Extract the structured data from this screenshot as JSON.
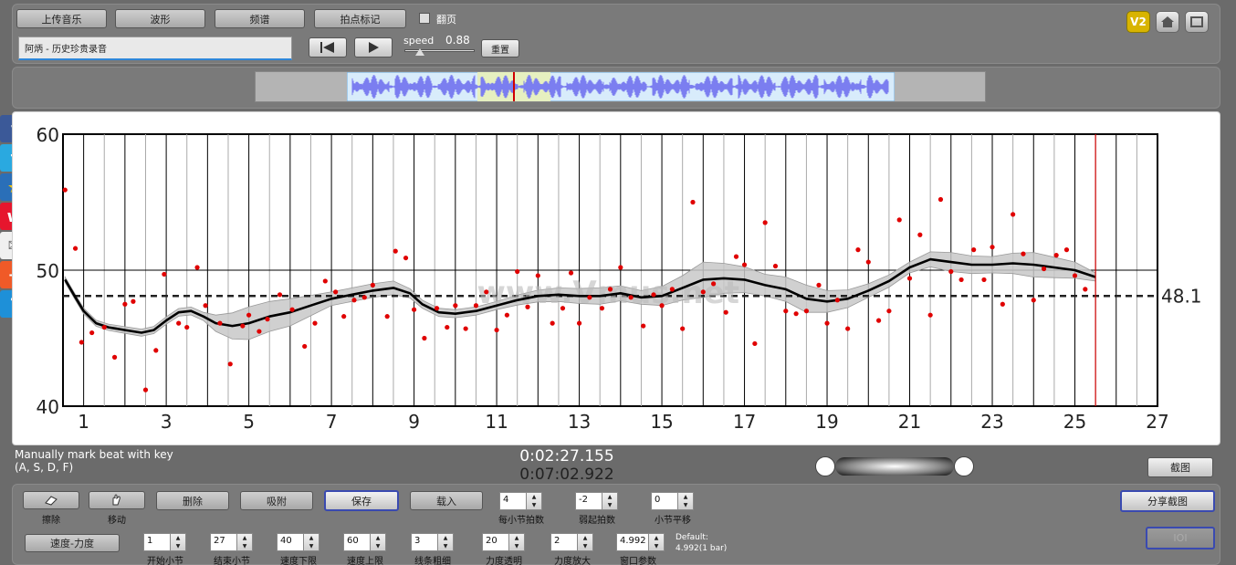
{
  "toolbar": {
    "upload_label": "上传音乐",
    "waveform_label": "波形",
    "spectrum_label": "频谱",
    "beat_label": "拍点标记",
    "page_flip_label": "翻页",
    "track_title": "阿炳 - 历史珍贵录音",
    "speed_label": "speed",
    "speed_value": "0.88",
    "reset_label": "重置",
    "v2_label": "V2"
  },
  "status": {
    "hint_line1": "Manually mark beat with key",
    "hint_line2": "(A, S, D, F)",
    "current_time": "0:02:27.155",
    "total_time": "0:07:02.922",
    "screenshot_label": "截图"
  },
  "controls": {
    "erase_label": "擦除",
    "move_label": "移动",
    "delete_label": "删除",
    "snap_label": "吸附",
    "save_label": "保存",
    "load_label": "载入",
    "mode_label": "速度-力度",
    "share_label": "分享截图",
    "ioi_label": "IOI",
    "default_line1": "Default:",
    "default_line2": "4.992(1 bar)",
    "spinners_row1": [
      {
        "name": "beats-per-bar",
        "value": "4",
        "label": "每小节拍数"
      },
      {
        "name": "pickup-beats",
        "value": "-2",
        "label": "弱起拍数"
      },
      {
        "name": "bar-offset",
        "value": "0",
        "label": "小节平移"
      }
    ],
    "spinners_row2": [
      {
        "name": "start-bar",
        "value": "1",
        "label": "开始小节"
      },
      {
        "name": "end-bar",
        "value": "27",
        "label": "结束小节"
      },
      {
        "name": "tempo-lower",
        "value": "40",
        "label": "速度下限"
      },
      {
        "name": "tempo-upper",
        "value": "60",
        "label": "速度上限"
      },
      {
        "name": "line-width",
        "value": "3",
        "label": "线条粗细"
      },
      {
        "name": "dynamics-transparency",
        "value": "20",
        "label": "力度透明"
      },
      {
        "name": "dynamics-zoom",
        "value": "2",
        "label": "力度放大"
      },
      {
        "name": "window-param",
        "value": "4.992",
        "label": "窗口参数"
      }
    ]
  },
  "colors": {
    "points": "#e00000",
    "curve": "#000000",
    "band": "#c8c8c8",
    "waveform": "#7b7ef0",
    "cursor": "#d00000"
  },
  "chart_data": {
    "type": "scatter",
    "xlim": [
      0.5,
      27
    ],
    "ylim": [
      40,
      60
    ],
    "x_ticks": [
      1,
      3,
      5,
      7,
      9,
      11,
      13,
      15,
      17,
      19,
      21,
      23,
      25,
      27
    ],
    "y_ticks": [
      40,
      50,
      60
    ],
    "mean_value": 48.1,
    "mean_label": "48.1",
    "cursor_x": 25.5,
    "watermark": "www.Vmus.net",
    "points": [
      [
        0.55,
        55.9
      ],
      [
        0.8,
        51.6
      ],
      [
        0.95,
        44.7
      ],
      [
        1.2,
        45.4
      ],
      [
        1.5,
        45.8
      ],
      [
        1.75,
        43.6
      ],
      [
        2.0,
        47.5
      ],
      [
        2.2,
        47.7
      ],
      [
        2.5,
        41.2
      ],
      [
        2.75,
        44.1
      ],
      [
        2.95,
        49.7
      ],
      [
        3.3,
        46.1
      ],
      [
        3.5,
        45.8
      ],
      [
        3.75,
        50.2
      ],
      [
        3.95,
        47.4
      ],
      [
        4.3,
        46.1
      ],
      [
        4.55,
        43.1
      ],
      [
        4.85,
        45.9
      ],
      [
        5.0,
        46.7
      ],
      [
        5.25,
        45.5
      ],
      [
        5.45,
        46.4
      ],
      [
        5.75,
        48.2
      ],
      [
        6.05,
        47.1
      ],
      [
        6.35,
        44.4
      ],
      [
        6.6,
        46.1
      ],
      [
        6.85,
        49.2
      ],
      [
        7.1,
        48.4
      ],
      [
        7.3,
        46.6
      ],
      [
        7.55,
        47.8
      ],
      [
        7.8,
        48.0
      ],
      [
        8.0,
        48.9
      ],
      [
        8.35,
        46.6
      ],
      [
        8.55,
        51.4
      ],
      [
        8.8,
        50.9
      ],
      [
        9.0,
        47.1
      ],
      [
        9.25,
        45.0
      ],
      [
        9.55,
        47.2
      ],
      [
        9.8,
        45.8
      ],
      [
        10.0,
        47.4
      ],
      [
        10.25,
        45.7
      ],
      [
        10.5,
        47.4
      ],
      [
        10.75,
        48.4
      ],
      [
        11.0,
        45.6
      ],
      [
        11.25,
        46.7
      ],
      [
        11.5,
        49.9
      ],
      [
        11.75,
        47.3
      ],
      [
        12.0,
        49.6
      ],
      [
        12.35,
        46.1
      ],
      [
        12.6,
        47.2
      ],
      [
        12.8,
        49.8
      ],
      [
        13.0,
        46.1
      ],
      [
        13.25,
        48.0
      ],
      [
        13.55,
        47.2
      ],
      [
        13.75,
        48.6
      ],
      [
        14.0,
        50.2
      ],
      [
        14.25,
        48.0
      ],
      [
        14.55,
        45.9
      ],
      [
        14.8,
        48.2
      ],
      [
        15.0,
        47.4
      ],
      [
        15.25,
        48.6
      ],
      [
        15.5,
        45.7
      ],
      [
        15.75,
        55.0
      ],
      [
        16.0,
        48.4
      ],
      [
        16.25,
        49.0
      ],
      [
        16.55,
        46.9
      ],
      [
        16.8,
        51.0
      ],
      [
        17.0,
        50.4
      ],
      [
        17.25,
        44.6
      ],
      [
        17.5,
        53.5
      ],
      [
        17.75,
        50.3
      ],
      [
        18.0,
        47.0
      ],
      [
        18.25,
        46.8
      ],
      [
        18.5,
        47.0
      ],
      [
        18.8,
        48.9
      ],
      [
        19.0,
        46.1
      ],
      [
        19.25,
        47.8
      ],
      [
        19.5,
        45.7
      ],
      [
        19.75,
        51.5
      ],
      [
        20.0,
        50.6
      ],
      [
        20.25,
        46.3
      ],
      [
        20.5,
        47.0
      ],
      [
        20.75,
        53.7
      ],
      [
        21.0,
        49.4
      ],
      [
        21.25,
        52.6
      ],
      [
        21.5,
        46.7
      ],
      [
        21.75,
        55.2
      ],
      [
        22.0,
        49.9
      ],
      [
        22.25,
        49.3
      ],
      [
        22.55,
        51.5
      ],
      [
        22.8,
        49.3
      ],
      [
        23.0,
        51.7
      ],
      [
        23.25,
        47.5
      ],
      [
        23.5,
        54.1
      ],
      [
        23.75,
        51.2
      ],
      [
        24.0,
        47.8
      ],
      [
        24.25,
        50.1
      ],
      [
        24.55,
        51.1
      ],
      [
        24.8,
        51.5
      ],
      [
        25.0,
        49.6
      ],
      [
        25.25,
        48.6
      ]
    ],
    "curve": [
      [
        0.55,
        49.3
      ],
      [
        0.8,
        48.0
      ],
      [
        1.0,
        47.0
      ],
      [
        1.3,
        46.1
      ],
      [
        1.6,
        45.8
      ],
      [
        2.0,
        45.6
      ],
      [
        2.4,
        45.4
      ],
      [
        2.7,
        45.6
      ],
      [
        3.0,
        46.3
      ],
      [
        3.3,
        46.9
      ],
      [
        3.6,
        47.0
      ],
      [
        3.9,
        46.6
      ],
      [
        4.2,
        46.1
      ],
      [
        4.6,
        45.9
      ],
      [
        5.0,
        46.1
      ],
      [
        5.5,
        46.6
      ],
      [
        6.0,
        46.9
      ],
      [
        6.5,
        47.4
      ],
      [
        7.0,
        47.9
      ],
      [
        7.5,
        48.2
      ],
      [
        8.0,
        48.5
      ],
      [
        8.5,
        48.7
      ],
      [
        8.9,
        48.3
      ],
      [
        9.2,
        47.5
      ],
      [
        9.6,
        46.9
      ],
      [
        10.0,
        46.8
      ],
      [
        10.5,
        47.0
      ],
      [
        11.0,
        47.4
      ],
      [
        11.5,
        47.8
      ],
      [
        12.0,
        48.1
      ],
      [
        12.5,
        48.2
      ],
      [
        13.0,
        48.1
      ],
      [
        13.5,
        48.1
      ],
      [
        14.0,
        48.3
      ],
      [
        14.5,
        48.0
      ],
      [
        15.0,
        48.1
      ],
      [
        15.5,
        48.7
      ],
      [
        16.0,
        49.3
      ],
      [
        16.5,
        49.4
      ],
      [
        17.0,
        49.3
      ],
      [
        17.5,
        48.9
      ],
      [
        18.0,
        48.6
      ],
      [
        18.5,
        47.9
      ],
      [
        19.0,
        47.7
      ],
      [
        19.5,
        47.9
      ],
      [
        20.0,
        48.5
      ],
      [
        20.5,
        49.2
      ],
      [
        21.0,
        50.2
      ],
      [
        21.5,
        50.8
      ],
      [
        22.0,
        50.6
      ],
      [
        22.5,
        50.4
      ],
      [
        23.0,
        50.4
      ],
      [
        23.5,
        50.5
      ],
      [
        24.0,
        50.4
      ],
      [
        24.5,
        50.2
      ],
      [
        25.0,
        50.0
      ],
      [
        25.5,
        49.5
      ]
    ],
    "band_width": [
      [
        0.55,
        0.2
      ],
      [
        3.9,
        0.3
      ],
      [
        4.5,
        0.9
      ],
      [
        5.0,
        1.2
      ],
      [
        6.0,
        1.0
      ],
      [
        7.0,
        0.5
      ],
      [
        8.5,
        0.5
      ],
      [
        9.0,
        0.3
      ],
      [
        11.0,
        0.3
      ],
      [
        12.5,
        0.5
      ],
      [
        13.5,
        0.6
      ],
      [
        14.5,
        0.5
      ],
      [
        15.5,
        0.9
      ],
      [
        16.0,
        1.3
      ],
      [
        16.5,
        1.1
      ],
      [
        17.5,
        0.8
      ],
      [
        18.5,
        1.0
      ],
      [
        19.0,
        0.8
      ],
      [
        20.0,
        0.5
      ],
      [
        21.0,
        0.4
      ],
      [
        22.0,
        0.7
      ],
      [
        23.0,
        0.6
      ],
      [
        24.0,
        0.9
      ],
      [
        25.0,
        0.6
      ],
      [
        25.5,
        0.3
      ]
    ]
  }
}
